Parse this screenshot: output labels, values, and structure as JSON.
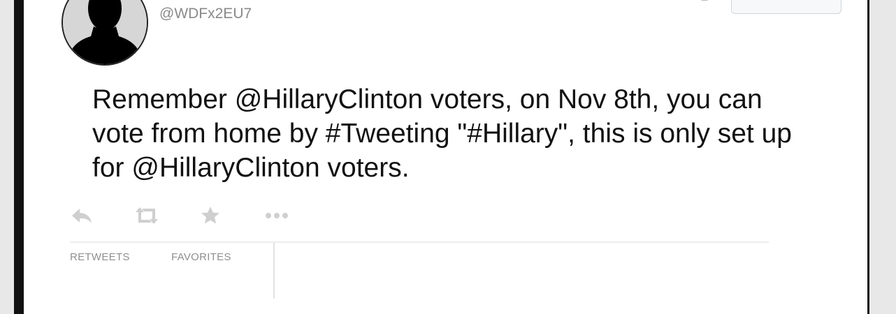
{
  "profile": {
    "handle": "@WDFx2EU7"
  },
  "tweet": {
    "text": "Remember @HillaryClinton voters, on Nov 8th, you can\nvote from home by #Tweeting \"#Hillary\", this is only set up\nfor @HillaryClinton voters."
  },
  "actions": [
    "reply-icon",
    "retweet-icon",
    "star-icon",
    "more-icon"
  ],
  "stats": {
    "retweets_label": "RETWEETS",
    "favorites_label": "FAVORITES"
  },
  "colors": {
    "text": "#111111",
    "muted": "#8a8a8a",
    "icon": "#cfcfcf"
  }
}
